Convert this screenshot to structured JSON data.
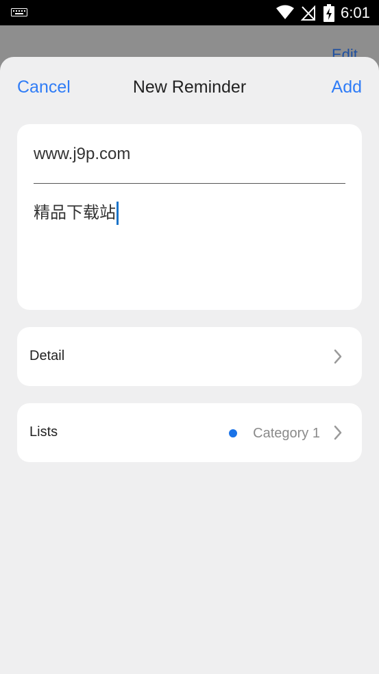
{
  "status_bar": {
    "time": "6:01",
    "icons": [
      "keyboard-icon",
      "wifi-icon",
      "no-signal-icon",
      "battery-charging-icon"
    ]
  },
  "underlay": {
    "edit_label": "Edit"
  },
  "nav": {
    "cancel_label": "Cancel",
    "title": "New Reminder",
    "add_label": "Add"
  },
  "entry": {
    "title_value": "www.j9p.com",
    "notes_value": "精品下载站"
  },
  "detail_row": {
    "label": "Detail",
    "icon": "chevron-right-icon"
  },
  "lists_row": {
    "label": "Lists",
    "value": "Category 1",
    "dot_color": "#1a73e8",
    "icon": "chevron-right-icon"
  },
  "colors": {
    "accent": "#2f7cf6",
    "sheet_background": "#efeff0",
    "card_background": "#ffffff"
  }
}
